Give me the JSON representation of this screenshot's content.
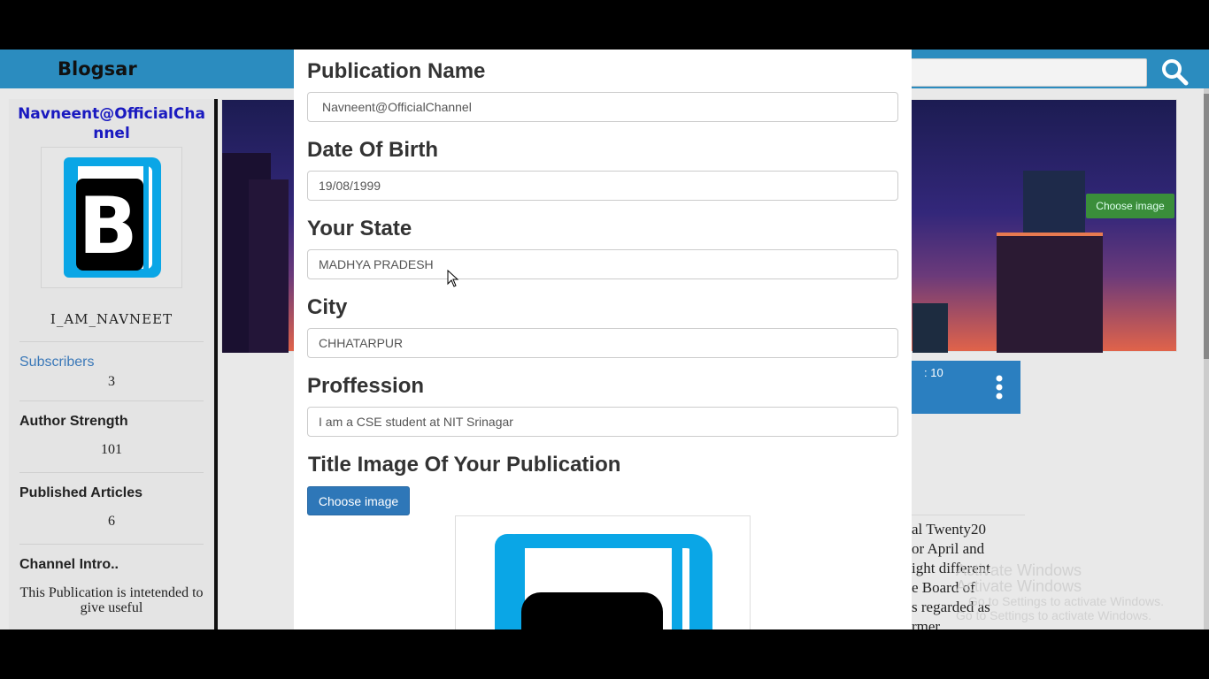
{
  "navbar": {
    "brand": "Blogsar",
    "search_placeholder": ""
  },
  "sidebar": {
    "channel_name": "Navneent@OfficialChannel",
    "username": "I_AM_NAVNEET",
    "subscribers_label": "Subscribers",
    "subscribers_value": "3",
    "author_strength_label": "Author Strength",
    "author_strength_value": "101",
    "published_label": "Published Articles",
    "published_value": "6",
    "intro_label": "Channel Intro..",
    "intro_text": "This Publication is intetended to give useful"
  },
  "cover": {
    "choose_image_label": "Choose image"
  },
  "card": {
    "header_text": ": 10",
    "body_lines": [
      "al Twenty20",
      "or April and",
      "ight different",
      "e Board of",
      "s regarded as",
      "rmer"
    ]
  },
  "watermark": {
    "line1": "Activate Windows",
    "line2": "Activate Windows",
    "line3": "Go to Settings to activate Windows.",
    "line4": "Go to Settings to activate Windows."
  },
  "modal": {
    "publication_name_label": "Publication Name",
    "publication_name_value": "Navneent@OfficialChannel",
    "dob_label": "Date Of Birth",
    "dob_value": "19/08/1999",
    "state_label": "Your State",
    "state_value": "MADHYA PRADESH",
    "city_label": "City",
    "city_value": "CHHATARPUR",
    "profession_label": "Proffession",
    "profession_value": "I am a CSE student at NIT Srinagar",
    "title_image_label": "Title Image Of Your Publication",
    "choose_image_label": "Choose image"
  },
  "colors": {
    "navbar": "#2b8cbf",
    "primary_button": "#2e77b8",
    "cover_button": "#3a8e3a",
    "channel_name": "#1a1ac0"
  },
  "icons": {
    "search": "search-icon",
    "menu": "kebab-menu-icon",
    "logo": "blogsar-b-logo-icon",
    "cursor": "mouse-cursor-icon"
  }
}
